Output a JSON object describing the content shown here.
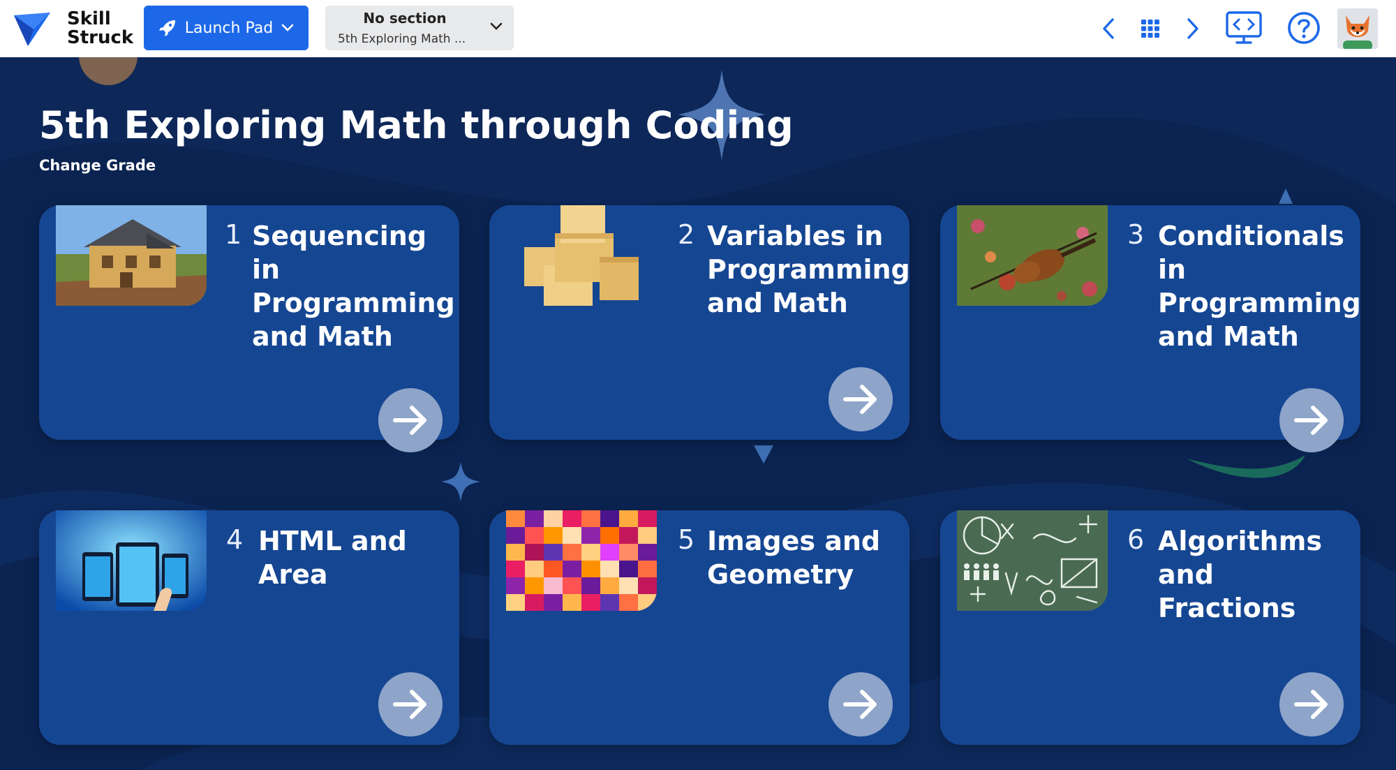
{
  "header": {
    "logo_line1": "Skill",
    "logo_line2": "Struck",
    "launch_label": "Launch Pad",
    "section_label": "No section",
    "course_short": "5th Exploring Math ..."
  },
  "page": {
    "title": "5th Exploring Math through Coding",
    "change_grade": "Change Grade"
  },
  "cards": [
    {
      "num": "1",
      "title": "Sequencing in Programming and Math",
      "thumb": "house-photo"
    },
    {
      "num": "2",
      "title": "Variables in Programming and Math",
      "thumb": "boxes-photo"
    },
    {
      "num": "3",
      "title": "Conditionals in Programming and Math",
      "thumb": "violin-photo"
    },
    {
      "num": "4",
      "title": "HTML and Area",
      "thumb": "devices-photo"
    },
    {
      "num": "5",
      "title": "Images and Geometry",
      "thumb": "mosaic-photo"
    },
    {
      "num": "6",
      "title": "Algorithms and Fractions",
      "thumb": "chalkboard-photo"
    }
  ],
  "colors": {
    "accent": "#1d68e8",
    "background": "#0b2350",
    "card": "#154692",
    "arrow_button": "#8ea4c9"
  }
}
